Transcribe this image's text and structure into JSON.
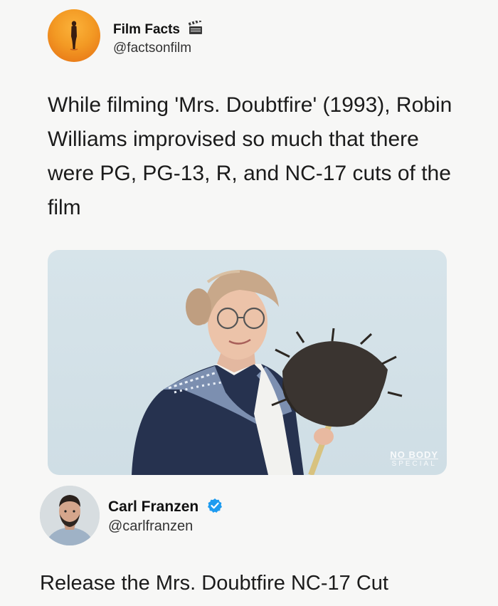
{
  "tweet1": {
    "author": {
      "name": "Film Facts",
      "handle": "@factsonfilm",
      "badge_icon": "clapperboard-icon"
    },
    "text": "While filming 'Mrs. Doubtfire' (1993), Robin Williams improvised so much that there were PG, PG-13, R, and NC-17 cuts of the film",
    "media": {
      "watermark_line1": "NO BODY",
      "watermark_line2": "SPECIAL"
    }
  },
  "tweet2": {
    "author": {
      "name": "Carl Franzen",
      "handle": "@carlfranzen",
      "badge_icon": "verified-badge-icon",
      "badge_color": "#1d9bf0"
    },
    "text": "Release the Mrs. Doubtfire NC-17 Cut"
  },
  "colors": {
    "background": "#f7f7f6",
    "avatar1_orange": "#f39a24"
  }
}
